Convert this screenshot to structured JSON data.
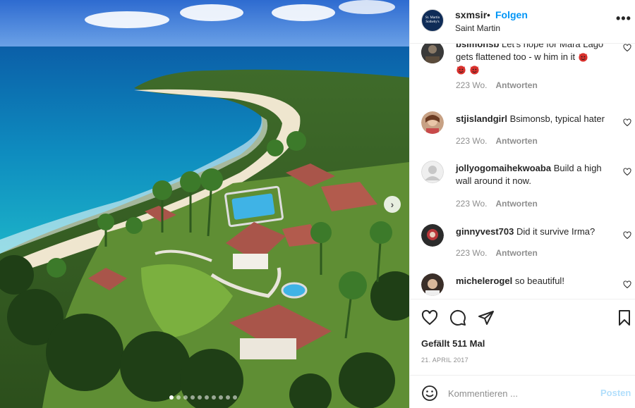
{
  "header": {
    "avatar_text": "St. Martin Sotheby's",
    "username": "sxmsir",
    "separator": "•",
    "follow_label": "Folgen",
    "location": "Saint Martin",
    "more_label": "•••"
  },
  "comments": [
    {
      "username": "bsimonsb",
      "text": "Let's hope for Mara Lago gets flattened too - w him in it",
      "emoji": [
        "devil-emoji",
        "devil-emoji",
        "devil-emoji"
      ],
      "age": "223 Wo.",
      "reply_label": "Antworten"
    },
    {
      "username": "stjislandgirl",
      "text": "Bsimonsb, typical hater",
      "age": "223 Wo.",
      "reply_label": "Antworten"
    },
    {
      "username": "jollyogomaihekwoaba",
      "text": "Build a high wall around it now.",
      "age": "223 Wo.",
      "reply_label": "Antworten"
    },
    {
      "username": "ginnyvest703",
      "text": "Did it survive Irma?",
      "age": "223 Wo.",
      "reply_label": "Antworten"
    },
    {
      "username": "michelerogel",
      "text": "so beautiful!"
    }
  ],
  "post": {
    "likes": "Gefällt 511 Mal",
    "date": "21. APRIL 2017"
  },
  "composer": {
    "placeholder": "Kommentieren ...",
    "post_label": "Posten"
  },
  "carousel": {
    "next_icon": "chevron-right-icon",
    "current_index": 1,
    "total": 10
  },
  "colors": {
    "link": "#0095f6",
    "post_disabled": "#b2dffc",
    "meta": "#8e8e8e",
    "text": "#262626"
  }
}
